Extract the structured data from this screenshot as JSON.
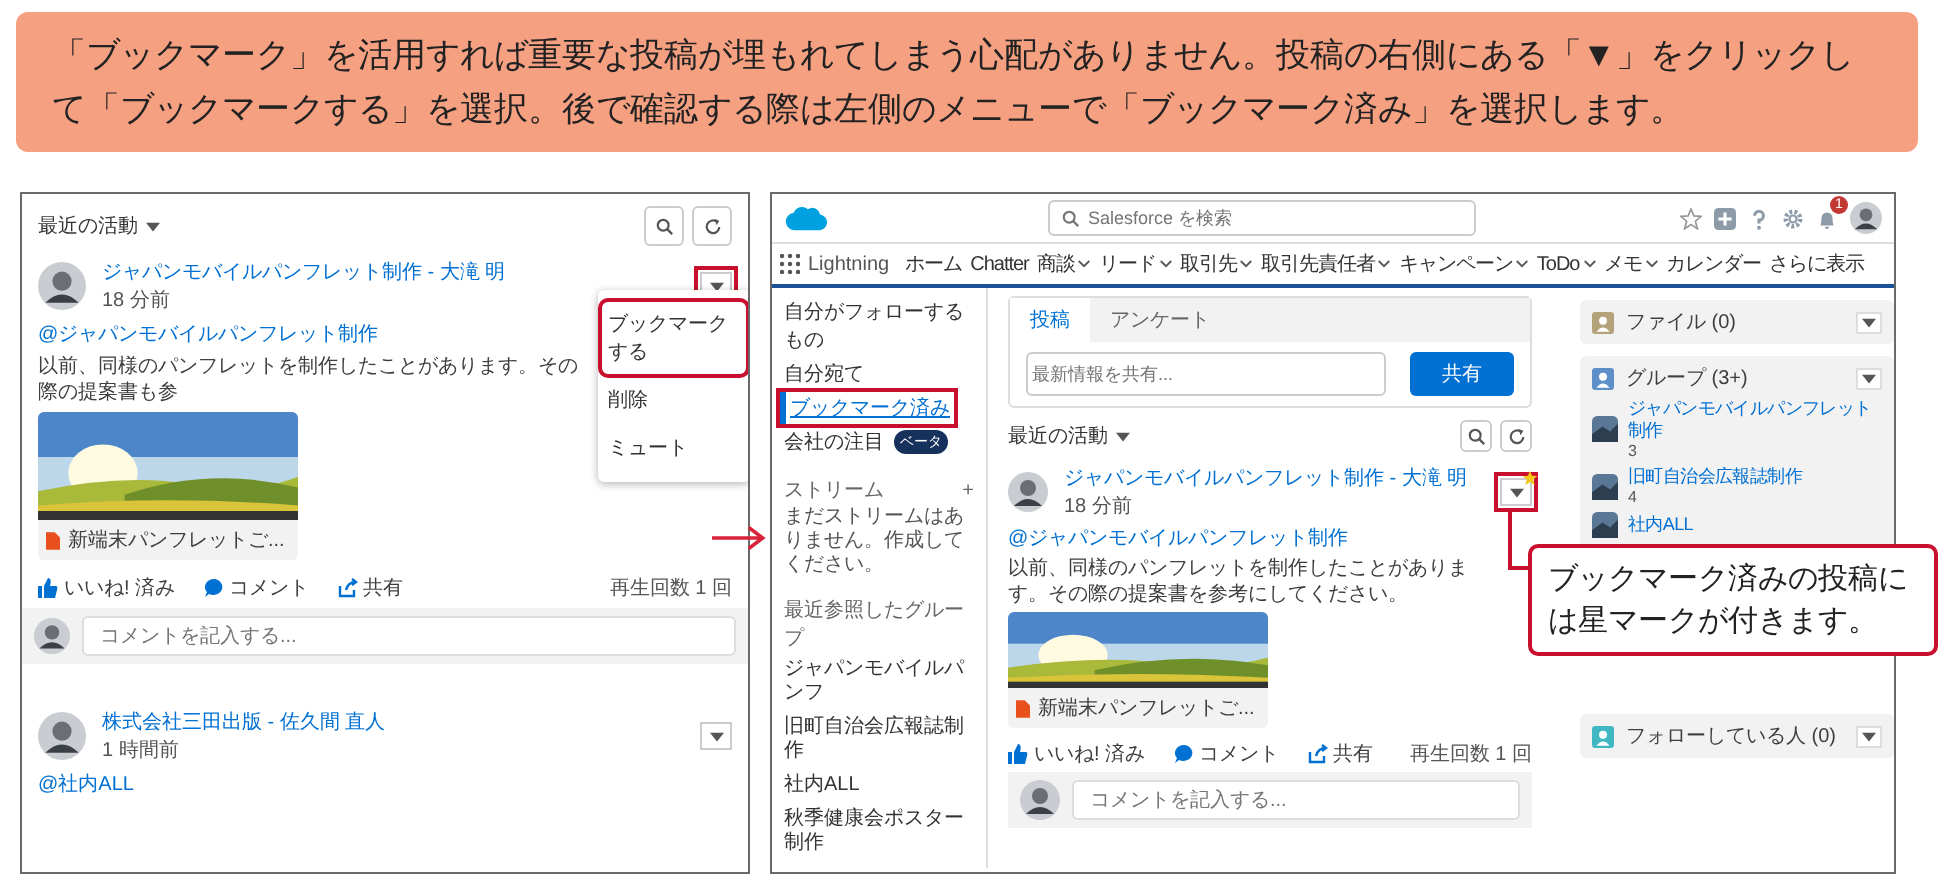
{
  "banner": {
    "text": "「ブックマーク」を活用すれば重要な投稿が埋もれてしまう心配がありません。投稿の右側にある「▼」をクリックして「ブックマークする」を選択。後で確認する際は左側のメニューで「ブックマーク済み」を選択します。"
  },
  "left_screen": {
    "feed_title": "最近の活動",
    "caret_highlighted": true,
    "posts": [
      {
        "author": "ジャパンモバイルパンフレット制作 - 大滝 明",
        "time": "18 分前",
        "mention": "@ジャパンモバイルパンフレット制作",
        "body": "以前、同様のパンフレットを制作したことがあります。その際の提案書も参",
        "attachment": "新端末パンフレットご...",
        "actions": [
          {
            "kind": "like",
            "label": "いいね! 済み"
          },
          {
            "kind": "comment",
            "label": "コメント"
          },
          {
            "kind": "share",
            "label": "共有"
          }
        ],
        "views": "再生回数 1 回",
        "comment_placeholder": "コメントを記入する..."
      },
      {
        "author": "株式会社三田出版 - 佐久間 直人",
        "time": "1 時間前",
        "mention": "@社内ALL"
      }
    ],
    "menu": [
      {
        "label": "ブックマークする",
        "highlighted": true
      },
      {
        "label": "削除",
        "highlighted": false
      },
      {
        "label": "ミュート",
        "highlighted": false
      }
    ]
  },
  "right_screen": {
    "search_placeholder": "Salesforce を検索",
    "notification_count": "1",
    "app_name": "Lightning",
    "nav": [
      "ホーム",
      "Chatter",
      "商談",
      "リード",
      "取引先",
      "取引先責任者",
      "キャンペーン",
      "ToDo",
      "メモ",
      "カレンダー",
      "さらに表示"
    ],
    "sidebar": [
      {
        "label": "自分がフォローするもの",
        "selected": false
      },
      {
        "label": "自分宛て",
        "selected": false
      },
      {
        "label": "ブックマーク済み",
        "selected": true
      },
      {
        "label": "会社の注目",
        "selected": false,
        "badge": "ベータ"
      }
    ],
    "streams": {
      "title": "ストリーム",
      "add": "+",
      "empty": "まだストリームはありません。作成してください。"
    },
    "recent_groups": {
      "title": "最近参照したグループ",
      "items": [
        "ジャパンモバイルパンフ",
        "旧町自治会広報誌制作",
        "社内ALL",
        "秋季健康会ポスター制作"
      ]
    },
    "composer": {
      "tabs": [
        {
          "label": "投稿",
          "selected": true
        },
        {
          "label": "アンケート",
          "selected": false
        }
      ],
      "placeholder": "最新情報を共有...",
      "button": "共有"
    },
    "feed_title": "最近の活動",
    "post": {
      "author": "ジャパンモバイルパンフレット制作 - 大滝 明",
      "time": "18 分前",
      "mention": "@ジャパンモバイルパンフレット制作",
      "body": "以前、同様のパンフレットを制作したことがあります。その際の提案書を参考にしてください。",
      "attachment": "新端末パンフレットご...",
      "actions": [
        {
          "kind": "like",
          "label": "いいね! 済み"
        },
        {
          "kind": "comment",
          "label": "コメント"
        },
        {
          "kind": "share",
          "label": "共有"
        }
      ],
      "views": "再生回数 1 回",
      "comment_placeholder": "コメントを記入する...",
      "bookmarked": true
    },
    "cards": [
      {
        "kind": "files",
        "title": "ファイル (0)"
      },
      {
        "kind": "groups",
        "title": "グループ (3+)",
        "items": [
          {
            "name": "ジャパンモバイルパンフレット制作",
            "count": "3"
          },
          {
            "name": "旧町自治会広報誌制作",
            "count": "4"
          },
          {
            "name": "社内ALL"
          }
        ]
      },
      {
        "kind": "people",
        "title": "フォローしている人 (0)"
      }
    ]
  },
  "callout": {
    "text": "ブックマーク済みの投稿には星マークが付きます。"
  }
}
